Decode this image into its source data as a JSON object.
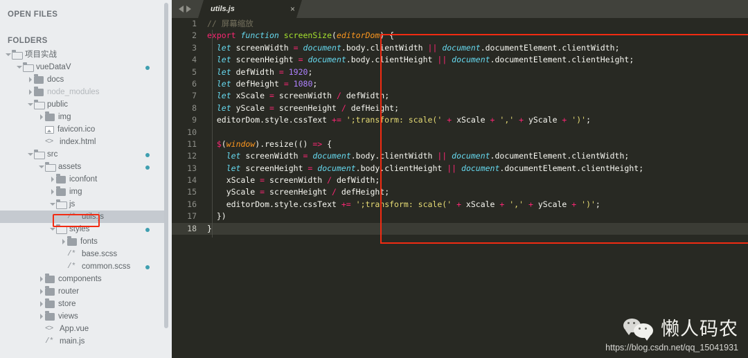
{
  "sidebar": {
    "open_files_header": "OPEN FILES",
    "folders_header": "FOLDERS",
    "tree": [
      {
        "label": "项目实战",
        "depth": 0,
        "arrow": "down",
        "icon": "folder-open",
        "dot": false,
        "dim": false,
        "selected": false
      },
      {
        "label": "vueDataV",
        "depth": 1,
        "arrow": "down",
        "icon": "folder-open",
        "dot": true,
        "dim": false,
        "selected": false
      },
      {
        "label": "docs",
        "depth": 2,
        "arrow": "right",
        "icon": "folder-closed",
        "dot": false,
        "dim": false,
        "selected": false
      },
      {
        "label": "node_modules",
        "depth": 2,
        "arrow": "right",
        "icon": "folder-closed",
        "dot": false,
        "dim": true,
        "selected": false
      },
      {
        "label": "public",
        "depth": 2,
        "arrow": "down",
        "icon": "folder-open",
        "dot": false,
        "dim": false,
        "selected": false
      },
      {
        "label": "img",
        "depth": 3,
        "arrow": "right",
        "icon": "folder-closed",
        "dot": false,
        "dim": false,
        "selected": false
      },
      {
        "label": "favicon.ico",
        "depth": 3,
        "arrow": "none",
        "icon": "image-file",
        "dot": false,
        "dim": false,
        "selected": false
      },
      {
        "label": "index.html",
        "depth": 3,
        "arrow": "none",
        "icon": "html-file",
        "dot": false,
        "dim": false,
        "selected": false
      },
      {
        "label": "src",
        "depth": 2,
        "arrow": "down",
        "icon": "folder-open",
        "dot": true,
        "dim": false,
        "selected": false
      },
      {
        "label": "assets",
        "depth": 3,
        "arrow": "down",
        "icon": "folder-open",
        "dot": true,
        "dim": false,
        "selected": false
      },
      {
        "label": "iconfont",
        "depth": 4,
        "arrow": "right",
        "icon": "folder-closed",
        "dot": false,
        "dim": false,
        "selected": false
      },
      {
        "label": "img",
        "depth": 4,
        "arrow": "right",
        "icon": "folder-closed",
        "dot": false,
        "dim": false,
        "selected": false
      },
      {
        "label": "js",
        "depth": 4,
        "arrow": "down",
        "icon": "folder-open",
        "dot": false,
        "dim": false,
        "selected": false
      },
      {
        "label": "utils.js",
        "depth": 5,
        "arrow": "none",
        "icon": "js-file",
        "dot": false,
        "dim": false,
        "selected": true
      },
      {
        "label": "styles",
        "depth": 4,
        "arrow": "down",
        "icon": "folder-open",
        "dot": true,
        "dim": false,
        "selected": false
      },
      {
        "label": "fonts",
        "depth": 5,
        "arrow": "right",
        "icon": "folder-closed",
        "dot": false,
        "dim": false,
        "selected": false
      },
      {
        "label": "base.scss",
        "depth": 5,
        "arrow": "none",
        "icon": "js-file",
        "dot": false,
        "dim": false,
        "selected": false
      },
      {
        "label": "common.scss",
        "depth": 5,
        "arrow": "none",
        "icon": "js-file",
        "dot": true,
        "dim": false,
        "selected": false
      },
      {
        "label": "components",
        "depth": 3,
        "arrow": "right",
        "icon": "folder-closed",
        "dot": false,
        "dim": false,
        "selected": false
      },
      {
        "label": "router",
        "depth": 3,
        "arrow": "right",
        "icon": "folder-closed",
        "dot": false,
        "dim": false,
        "selected": false
      },
      {
        "label": "store",
        "depth": 3,
        "arrow": "right",
        "icon": "folder-closed",
        "dot": false,
        "dim": false,
        "selected": false
      },
      {
        "label": "views",
        "depth": 3,
        "arrow": "right",
        "icon": "folder-closed",
        "dot": false,
        "dim": false,
        "selected": false
      },
      {
        "label": "App.vue",
        "depth": 3,
        "arrow": "none",
        "icon": "html-file",
        "dot": false,
        "dim": false,
        "selected": false
      },
      {
        "label": "main.js",
        "depth": 3,
        "arrow": "none",
        "icon": "js-file",
        "dot": false,
        "dim": false,
        "selected": false
      }
    ],
    "js_icon_glyph": "/*",
    "html_icon_glyph": "<>"
  },
  "editor": {
    "nav_back_icon": "arrow-left-icon",
    "nav_forward_icon": "arrow-right-icon",
    "tab_label": "utils.js",
    "tab_close_glyph": "×",
    "current_line": 18,
    "lines": [
      {
        "n": 1,
        "tokens": [
          {
            "t": "// 屏幕缩放",
            "c": "cmt"
          }
        ]
      },
      {
        "n": 2,
        "tokens": [
          {
            "t": "export ",
            "c": "kw"
          },
          {
            "t": "function ",
            "c": "fn"
          },
          {
            "t": "screenSize",
            "c": "nm"
          },
          {
            "t": "(",
            "c": "wh"
          },
          {
            "t": "editorDom",
            "c": "par"
          },
          {
            "t": ") {",
            "c": "wh"
          }
        ]
      },
      {
        "n": 3,
        "tokens": [
          {
            "t": "  ",
            "c": "wh"
          },
          {
            "t": "let ",
            "c": "fn"
          },
          {
            "t": "screenWidth ",
            "c": "wh"
          },
          {
            "t": "= ",
            "c": "kw"
          },
          {
            "t": "document",
            "c": "doc"
          },
          {
            "t": ".body.clientWidth ",
            "c": "wh"
          },
          {
            "t": "|| ",
            "c": "kw"
          },
          {
            "t": "document",
            "c": "doc"
          },
          {
            "t": ".documentElement.clientWidth;",
            "c": "wh"
          }
        ]
      },
      {
        "n": 4,
        "tokens": [
          {
            "t": "  ",
            "c": "wh"
          },
          {
            "t": "let ",
            "c": "fn"
          },
          {
            "t": "screenHeight ",
            "c": "wh"
          },
          {
            "t": "= ",
            "c": "kw"
          },
          {
            "t": "document",
            "c": "doc"
          },
          {
            "t": ".body.clientHeight ",
            "c": "wh"
          },
          {
            "t": "|| ",
            "c": "kw"
          },
          {
            "t": "document",
            "c": "doc"
          },
          {
            "t": ".documentElement.clientHeight;",
            "c": "wh"
          }
        ]
      },
      {
        "n": 5,
        "tokens": [
          {
            "t": "  ",
            "c": "wh"
          },
          {
            "t": "let ",
            "c": "fn"
          },
          {
            "t": "defWidth ",
            "c": "wh"
          },
          {
            "t": "= ",
            "c": "kw"
          },
          {
            "t": "1920",
            "c": "num"
          },
          {
            "t": ";",
            "c": "wh"
          }
        ]
      },
      {
        "n": 6,
        "tokens": [
          {
            "t": "  ",
            "c": "wh"
          },
          {
            "t": "let ",
            "c": "fn"
          },
          {
            "t": "defHeight ",
            "c": "wh"
          },
          {
            "t": "= ",
            "c": "kw"
          },
          {
            "t": "1080",
            "c": "num"
          },
          {
            "t": ";",
            "c": "wh"
          }
        ]
      },
      {
        "n": 7,
        "tokens": [
          {
            "t": "  ",
            "c": "wh"
          },
          {
            "t": "let ",
            "c": "fn"
          },
          {
            "t": "xScale ",
            "c": "wh"
          },
          {
            "t": "= ",
            "c": "kw"
          },
          {
            "t": "screenWidth ",
            "c": "wh"
          },
          {
            "t": "/ ",
            "c": "kw"
          },
          {
            "t": "defWidth;",
            "c": "wh"
          }
        ]
      },
      {
        "n": 8,
        "tokens": [
          {
            "t": "  ",
            "c": "wh"
          },
          {
            "t": "let ",
            "c": "fn"
          },
          {
            "t": "yScale ",
            "c": "wh"
          },
          {
            "t": "= ",
            "c": "kw"
          },
          {
            "t": "screenHeight ",
            "c": "wh"
          },
          {
            "t": "/ ",
            "c": "kw"
          },
          {
            "t": "defHeight;",
            "c": "wh"
          }
        ]
      },
      {
        "n": 9,
        "tokens": [
          {
            "t": "  editorDom.style.cssText ",
            "c": "wh"
          },
          {
            "t": "+= ",
            "c": "kw"
          },
          {
            "t": "';transform: scale('",
            "c": "str"
          },
          {
            "t": " + ",
            "c": "kw"
          },
          {
            "t": "xScale ",
            "c": "wh"
          },
          {
            "t": "+ ",
            "c": "kw"
          },
          {
            "t": "','",
            "c": "str"
          },
          {
            "t": " + ",
            "c": "kw"
          },
          {
            "t": "yScale ",
            "c": "wh"
          },
          {
            "t": "+ ",
            "c": "kw"
          },
          {
            "t": "')'",
            "c": "str"
          },
          {
            "t": ";",
            "c": "wh"
          }
        ]
      },
      {
        "n": 10,
        "tokens": []
      },
      {
        "n": 11,
        "tokens": [
          {
            "t": "  ",
            "c": "wh"
          },
          {
            "t": "$",
            "c": "kw"
          },
          {
            "t": "(",
            "c": "wh"
          },
          {
            "t": "window",
            "c": "par"
          },
          {
            "t": ").resize(() ",
            "c": "wh"
          },
          {
            "t": "=> ",
            "c": "kw"
          },
          {
            "t": "{",
            "c": "wh"
          }
        ]
      },
      {
        "n": 12,
        "tokens": [
          {
            "t": "    ",
            "c": "wh"
          },
          {
            "t": "let ",
            "c": "fn"
          },
          {
            "t": "screenWidth ",
            "c": "wh"
          },
          {
            "t": "= ",
            "c": "kw"
          },
          {
            "t": "document",
            "c": "doc"
          },
          {
            "t": ".body.clientWidth ",
            "c": "wh"
          },
          {
            "t": "|| ",
            "c": "kw"
          },
          {
            "t": "document",
            "c": "doc"
          },
          {
            "t": ".documentElement.clientWidth;",
            "c": "wh"
          }
        ]
      },
      {
        "n": 13,
        "tokens": [
          {
            "t": "    ",
            "c": "wh"
          },
          {
            "t": "let ",
            "c": "fn"
          },
          {
            "t": "screenHeight ",
            "c": "wh"
          },
          {
            "t": "= ",
            "c": "kw"
          },
          {
            "t": "document",
            "c": "doc"
          },
          {
            "t": ".body.clientHeight ",
            "c": "wh"
          },
          {
            "t": "|| ",
            "c": "kw"
          },
          {
            "t": "document",
            "c": "doc"
          },
          {
            "t": ".documentElement.clientHeight;",
            "c": "wh"
          }
        ]
      },
      {
        "n": 14,
        "tokens": [
          {
            "t": "    xScale ",
            "c": "wh"
          },
          {
            "t": "= ",
            "c": "kw"
          },
          {
            "t": "screenWidth ",
            "c": "wh"
          },
          {
            "t": "/ ",
            "c": "kw"
          },
          {
            "t": "defWidth;",
            "c": "wh"
          }
        ]
      },
      {
        "n": 15,
        "tokens": [
          {
            "t": "    yScale ",
            "c": "wh"
          },
          {
            "t": "= ",
            "c": "kw"
          },
          {
            "t": "screenHeight ",
            "c": "wh"
          },
          {
            "t": "/ ",
            "c": "kw"
          },
          {
            "t": "defHeight;",
            "c": "wh"
          }
        ]
      },
      {
        "n": 16,
        "tokens": [
          {
            "t": "    editorDom.style.cssText ",
            "c": "wh"
          },
          {
            "t": "+= ",
            "c": "kw"
          },
          {
            "t": "';transform: scale('",
            "c": "str"
          },
          {
            "t": " + ",
            "c": "kw"
          },
          {
            "t": "xScale ",
            "c": "wh"
          },
          {
            "t": "+ ",
            "c": "kw"
          },
          {
            "t": "','",
            "c": "str"
          },
          {
            "t": " + ",
            "c": "kw"
          },
          {
            "t": "yScale ",
            "c": "wh"
          },
          {
            "t": "+ ",
            "c": "kw"
          },
          {
            "t": "')'",
            "c": "str"
          },
          {
            "t": ";",
            "c": "wh"
          }
        ]
      },
      {
        "n": 17,
        "tokens": [
          {
            "t": "  })",
            "c": "wh"
          }
        ]
      },
      {
        "n": 18,
        "tokens": [
          {
            "t": "}",
            "c": "wh"
          }
        ]
      }
    ]
  },
  "annotations": {
    "code_box_color": "#f22b12",
    "file_box_color": "#f22b12"
  },
  "watermark": {
    "icon": "wechat-icon",
    "name": "懒人码农",
    "url": "https://blog.csdn.net/qq_15041931"
  }
}
